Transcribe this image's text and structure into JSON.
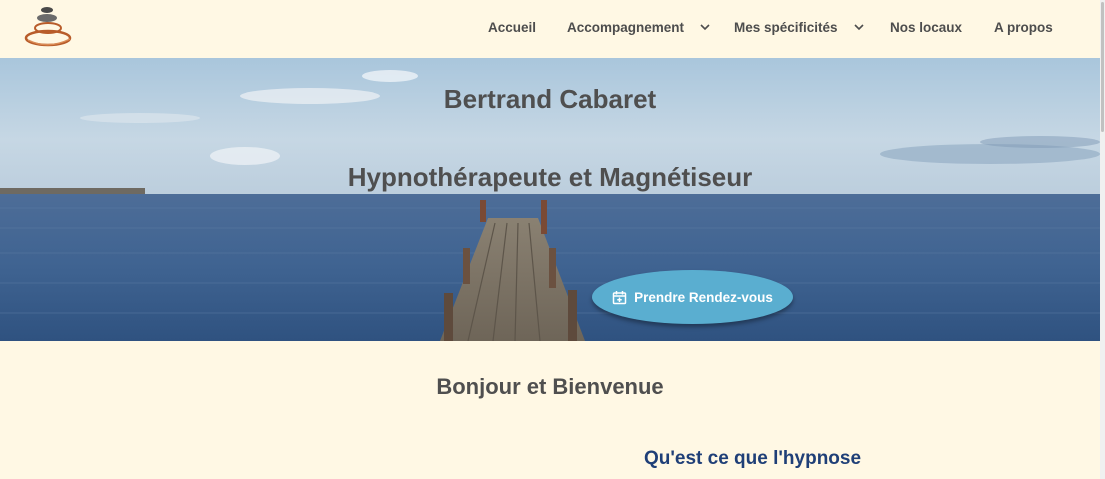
{
  "nav": {
    "items": [
      {
        "label": "Accueil"
      },
      {
        "label": "Accompagnement"
      },
      {
        "label": "Mes spécificités"
      },
      {
        "label": "Nos locaux"
      },
      {
        "label": "A propos"
      }
    ]
  },
  "hero": {
    "name": "Bertrand Cabaret",
    "subtitle": "Hypnothérapeute et Magnétiseur",
    "cta_label": "Prendre Rendez-vous"
  },
  "main": {
    "welcome": "Bonjour et Bienvenue",
    "hypnose_link": "Qu'est ce que l'hypnose"
  },
  "colors": {
    "background": "#fff8e4",
    "nav_text": "#4d4d4d",
    "heading_text": "#4f4f4f",
    "cta": "#5aaed0",
    "link": "#1f3f77"
  },
  "icons": {
    "logo": "stacked-stones-logo",
    "cta_icon": "calendar-plus-icon",
    "dropdown": "chevron-down-icon"
  }
}
